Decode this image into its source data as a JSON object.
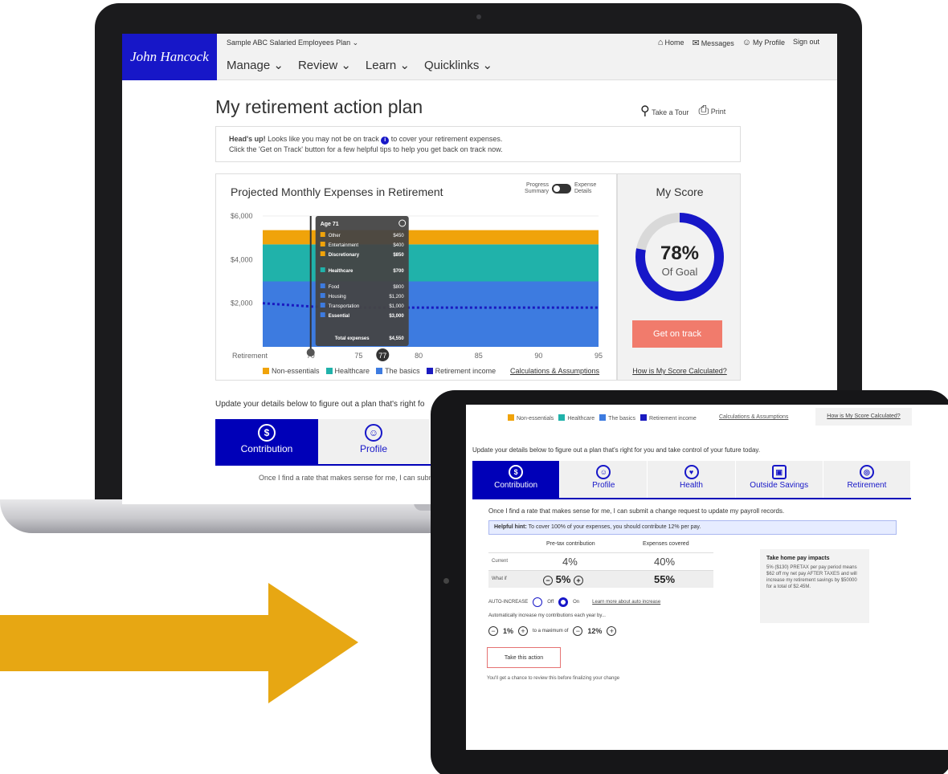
{
  "colors": {
    "brand_blue": "#1717c8",
    "tab_blue": "#0000b8",
    "cta_salmon": "#f17b6c",
    "arrow_gold": "#e7a713",
    "non_essentials": "#f0a30a",
    "healthcare": "#20b2aa",
    "basics": "#3d7be0",
    "income_line": "#1a1ac0"
  },
  "header": {
    "logo": "John Hancock",
    "plan_selector": "Sample ABC Salaried Employees Plan",
    "utility": {
      "home": "Home",
      "messages": "Messages",
      "profile": "My Profile",
      "signout": "Sign out"
    },
    "nav": [
      "Manage",
      "Review",
      "Learn",
      "Quicklinks"
    ]
  },
  "page": {
    "title": "My retirement action plan",
    "take_tour": "Take a Tour",
    "print": "Print",
    "alert_line1_lead": "Head's up!",
    "alert_line1_rest": "Looks like you may not be on track",
    "alert_line1_tail": "to cover your retirement expenses.",
    "alert_line2": "Click the 'Get on Track' button for a few helpful tips to help you get back on track now."
  },
  "chart_data": {
    "type": "area",
    "title": "Projected Monthly Expenses in Retirement",
    "toggle_left": "Progress Summary",
    "toggle_right": "Expense Details",
    "x_ticks": [
      "Retirement",
      "70",
      "75",
      "77",
      "80",
      "85",
      "90",
      "95"
    ],
    "x_values": [
      67,
      71,
      75,
      77,
      80,
      85,
      90,
      95
    ],
    "y_ticks": [
      "$6,000",
      "$4,000",
      "$2,000"
    ],
    "ylim": [
      0,
      6000
    ],
    "series": [
      {
        "name": "The basics",
        "values": [
          3000,
          3000,
          3000,
          3000,
          3000,
          3000,
          3000,
          3000
        ]
      },
      {
        "name": "Healthcare",
        "values": [
          1700,
          1700,
          1700,
          1700,
          1700,
          1700,
          1700,
          1700
        ]
      },
      {
        "name": "Non-essentials",
        "values": [
          650,
          650,
          650,
          650,
          650,
          650,
          650,
          650
        ]
      }
    ],
    "income_line": {
      "name": "Retirement income",
      "values": [
        2000,
        1850,
        1800,
        1800,
        1800,
        1800,
        1800,
        1800
      ]
    },
    "tooltip": {
      "title": "Age 71",
      "rows": [
        {
          "label": "Other",
          "value": "$450",
          "bold": false,
          "color": "#f0a30a"
        },
        {
          "label": "Entertainment",
          "value": "$400",
          "bold": false,
          "color": "#f0a30a"
        },
        {
          "label": "Discretionary",
          "value": "$850",
          "bold": true,
          "color": "#f0a30a"
        },
        {
          "label": "Healthcare",
          "value": "$700",
          "bold": true,
          "color": "#20b2aa"
        },
        {
          "label": "Food",
          "value": "$800",
          "bold": false,
          "color": "#3d7be0"
        },
        {
          "label": "Housing",
          "value": "$1,200",
          "bold": false,
          "color": "#3d7be0"
        },
        {
          "label": "Transportation",
          "value": "$1,000",
          "bold": false,
          "color": "#3d7be0"
        },
        {
          "label": "Essential",
          "value": "$3,000",
          "bold": true,
          "color": "#3d7be0"
        }
      ],
      "total_label": "Total expenses",
      "total_value": "$4,550"
    },
    "legend": [
      "Non-essentials",
      "Healthcare",
      "The basics",
      "Retirement income"
    ],
    "calc_link": "Calculations & Assumptions"
  },
  "score": {
    "title": "My Score",
    "value": 0.78,
    "pct": "78%",
    "label": "Of Goal",
    "button": "Get on track",
    "link": "How is My Score Calculated?"
  },
  "details": {
    "update_text_laptop": "Update your details below to figure out a plan that's right fo",
    "tabs": [
      "Contribution",
      "Profile",
      "Health",
      "Outside Savings",
      "Retirement"
    ],
    "cut_text": "Once I find a rate that makes sense for me, I can subm"
  },
  "tablet": {
    "legend": [
      "Non-essentials",
      "Healthcare",
      "The basics",
      "Retirement income"
    ],
    "calc_link": "Calculations & Assumptions",
    "score_link": "How is My Score Calculated?",
    "update_text": "Update your details below to figure out a plan that's right for you and take control of your future today.",
    "once_text": "Once I find a rate that makes sense for me, I can submit a change request to update my payroll records.",
    "hint_label": "Helpful hint:",
    "hint_text": "To cover 100% of your expenses, you should contribute 12% per pay.",
    "col_pretax": "Pre-tax contribution",
    "col_expenses": "Expenses covered",
    "row_current": "Current",
    "row_whatif": "What if",
    "current_pretax": "4%",
    "current_expenses": "40%",
    "whatif_pretax": "5%",
    "whatif_expenses": "55%",
    "impact_title": "Take home pay impacts",
    "impact_text": "5% ($130) PRETAX per pay period means $62 off my net pay AFTER TAXES and will increase my retirement savings by $50000 for a total of $2.45M.",
    "auto_label": "AUTO-INCREASE",
    "auto_off": "Off",
    "auto_on": "On",
    "auto_learn": "Learn more about auto increase",
    "auto_text": "Automatically increase my contributions each year by...",
    "step_increase": "1%",
    "step_mid": "to a maximum of",
    "step_max": "12%",
    "action_button": "Take this action",
    "review_text": "You'll get a chance to review this before finalizing your change"
  }
}
